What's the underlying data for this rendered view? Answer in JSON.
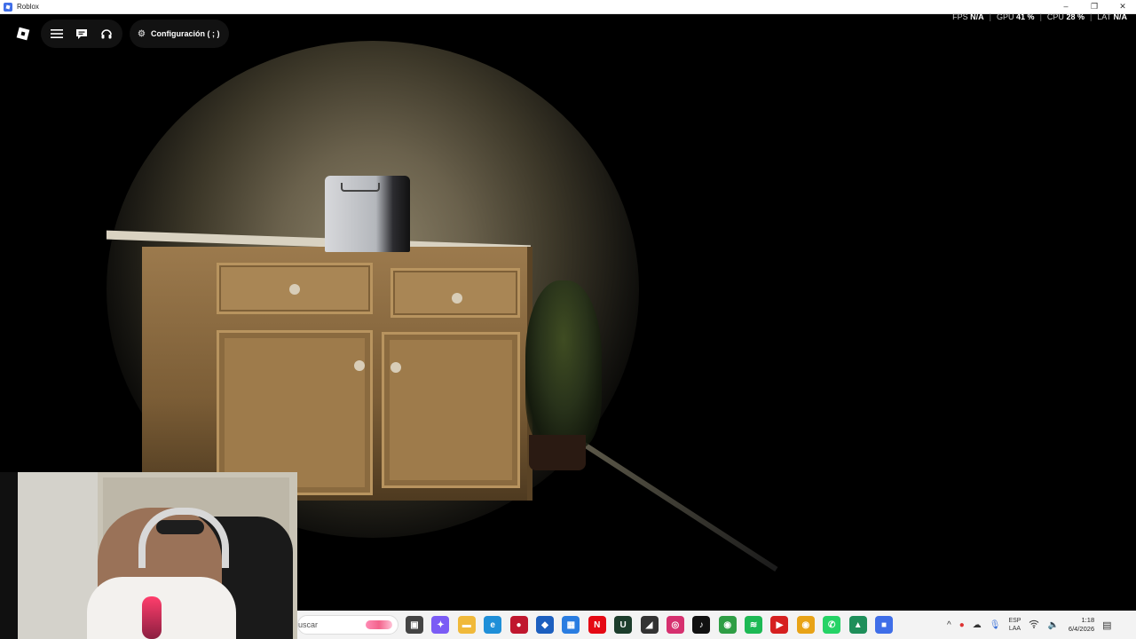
{
  "window": {
    "title": "Roblox",
    "controls": [
      "–",
      "❐",
      "✕"
    ]
  },
  "game_ui": {
    "config_label": "Configuración ( ; )",
    "stats": [
      {
        "label": "FPS",
        "value": "N/A"
      },
      {
        "label": "GPU",
        "value": "41 %"
      },
      {
        "label": "CPU",
        "value": "28 %"
      },
      {
        "label": "LAT",
        "value": "N/A"
      }
    ]
  },
  "taskbar": {
    "search_placeholder": "uscar",
    "apps": [
      {
        "name": "task-view-icon",
        "glyph": "▣",
        "color": "#444444"
      },
      {
        "name": "copilot-icon",
        "glyph": "✦",
        "color": "#7b5cf5"
      },
      {
        "name": "file-explorer-icon",
        "glyph": "▬",
        "color": "#f0b93a"
      },
      {
        "name": "edge-icon",
        "glyph": "e",
        "color": "#1f8fd8"
      },
      {
        "name": "app-red-circle-icon",
        "glyph": "●",
        "color": "#c0172e"
      },
      {
        "name": "security-app-icon",
        "glyph": "◆",
        "color": "#1c5fbf"
      },
      {
        "name": "store-icon",
        "glyph": "▦",
        "color": "#2a7de1"
      },
      {
        "name": "netflix-icon",
        "glyph": "N",
        "color": "#e50914"
      },
      {
        "name": "upwork-icon",
        "glyph": "U",
        "color": "#1c3d2c"
      },
      {
        "name": "sticky-notes-icon",
        "glyph": "◢",
        "color": "#333333"
      },
      {
        "name": "instagram-icon",
        "glyph": "◎",
        "color": "#d6306f"
      },
      {
        "name": "tiktok-icon",
        "glyph": "♪",
        "color": "#111111"
      },
      {
        "name": "chrome-icon",
        "glyph": "◉",
        "color": "#2f9e45"
      },
      {
        "name": "spotify-icon",
        "glyph": "≋",
        "color": "#1db954"
      },
      {
        "name": "youtube-app-icon",
        "glyph": "▶",
        "color": "#d62020"
      },
      {
        "name": "chrome-canary-icon",
        "glyph": "◉",
        "color": "#e8a317"
      },
      {
        "name": "whatsapp-icon",
        "glyph": "✆",
        "color": "#25d366"
      },
      {
        "name": "android-app-icon",
        "glyph": "▲",
        "color": "#1e8f5a"
      },
      {
        "name": "roblox-icon",
        "glyph": "■",
        "color": "#3f6ee8"
      }
    ],
    "tray": {
      "chevron": "^",
      "lang_top": "ESP",
      "lang_bottom": "LAA",
      "time": "1:18",
      "date": "6/4/2026"
    }
  }
}
